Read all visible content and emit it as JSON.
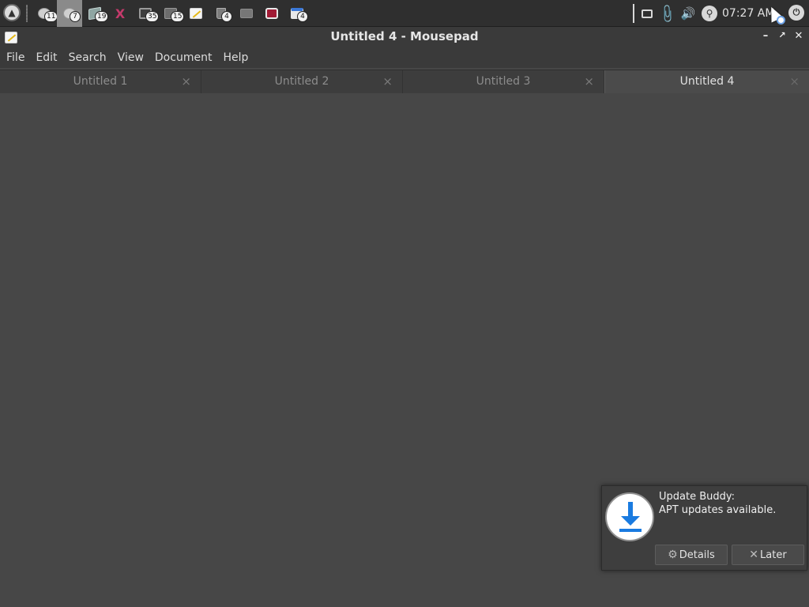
{
  "panel": {
    "menu_glyph": "▲",
    "tasks": [
      {
        "icon": "globe",
        "badge": "11",
        "active": false
      },
      {
        "icon": "globe",
        "badge": "7",
        "active": true
      },
      {
        "icon": "box",
        "badge": "19",
        "active": false
      },
      {
        "icon": "x",
        "badge": "",
        "active": false
      },
      {
        "icon": "monitor",
        "badge": "35",
        "active": false
      },
      {
        "icon": "windows",
        "badge": "15",
        "active": false
      },
      {
        "icon": "note",
        "badge": "",
        "active": false
      },
      {
        "icon": "trash",
        "badge": "4",
        "active": false
      },
      {
        "icon": "folder",
        "badge": "",
        "active": false
      },
      {
        "icon": "bag",
        "badge": "",
        "active": false
      },
      {
        "icon": "window",
        "badge": "4",
        "active": false
      }
    ],
    "clock": "07:27 AM"
  },
  "window": {
    "title": "Untitled 4 - Mousepad",
    "minimize_glyph": "–",
    "maximize_glyph": "↗",
    "close_glyph": "✕"
  },
  "menubar": {
    "items": [
      "File",
      "Edit",
      "Search",
      "View",
      "Document",
      "Help"
    ]
  },
  "tabs": [
    {
      "label": "Untitled 1",
      "active": false
    },
    {
      "label": "Untitled 2",
      "active": false
    },
    {
      "label": "Untitled 3",
      "active": false
    },
    {
      "label": "Untitled 4",
      "active": true
    }
  ],
  "tab_close_glyph": "×",
  "notification": {
    "title": "Update Buddy:",
    "body": "APT updates available.",
    "details_label": "Details",
    "later_label": "Later",
    "accent_color": "#1a7be0"
  }
}
